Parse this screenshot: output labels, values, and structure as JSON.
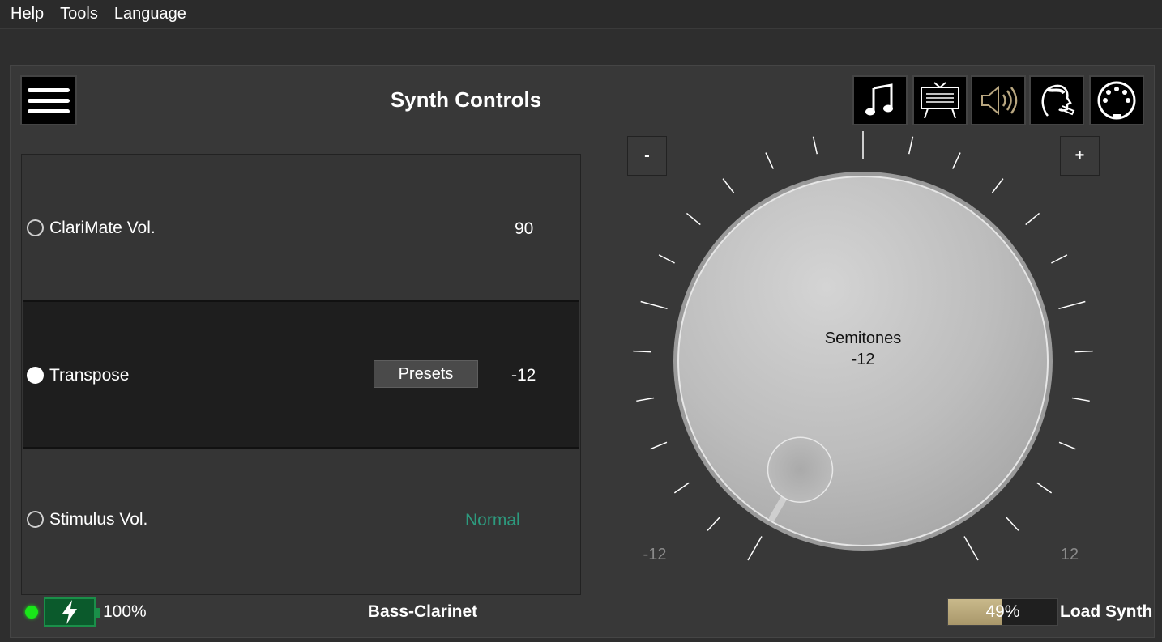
{
  "menubar": {
    "items": [
      "Help",
      "Tools",
      "Language"
    ]
  },
  "header": {
    "title": "Synth Controls"
  },
  "toolbar": {
    "buttons": [
      {
        "name": "music-note-icon"
      },
      {
        "name": "score-stand-icon"
      },
      {
        "name": "speaker-icon"
      },
      {
        "name": "player-face-icon"
      },
      {
        "name": "midi-port-icon"
      }
    ]
  },
  "controls": {
    "rows": [
      {
        "label": "ClariMate Vol.",
        "value": "90",
        "selected": false
      },
      {
        "label": "Transpose",
        "value": "-12",
        "selected": true,
        "button": "Presets"
      },
      {
        "label": "Stimulus Vol.",
        "value": "Normal",
        "selected": false
      }
    ]
  },
  "knob": {
    "label": "Semitones",
    "value": "-12",
    "min_label": "-12",
    "max_label": "12",
    "min": -12,
    "max": 12,
    "current": -12,
    "minus_label": "-",
    "plus_label": "+"
  },
  "status": {
    "battery_pct": "100%",
    "instrument": "Bass-Clarinet",
    "load_progress": 0.49,
    "load_pct": "49%",
    "load_label": "Load Synth"
  },
  "colors": {
    "led": "#19e619",
    "battery": "#0b5a2c",
    "progress": "#c9b98b",
    "normal_text": "#2d9a7e"
  }
}
